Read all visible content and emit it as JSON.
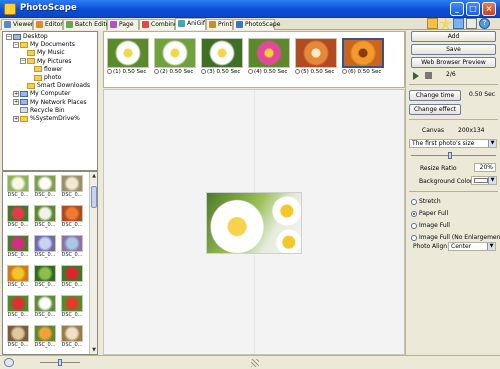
{
  "window": {
    "title": "PhotoScape"
  },
  "tabs": [
    {
      "label": "Viewer",
      "color": "#4f8bd6"
    },
    {
      "label": "Editor",
      "color": "#e08a2f"
    },
    {
      "label": "Batch Editor",
      "color": "#6aa84f"
    },
    {
      "label": "Page",
      "color": "#b64fc9"
    },
    {
      "label": "Combine",
      "color": "#d94b4b"
    },
    {
      "label": "AniGif",
      "color": "#3fa7b7"
    },
    {
      "label": "Print",
      "color": "#c78f2b"
    },
    {
      "label": "PhotoScape",
      "color": "#3b73c8"
    }
  ],
  "active_tab": "AniGif",
  "folder_tree": [
    {
      "label": "Desktop",
      "indent": 0,
      "expander": "-",
      "icon": "pc"
    },
    {
      "label": "My Documents",
      "indent": 1,
      "expander": "-",
      "icon": "folder"
    },
    {
      "label": "My Music",
      "indent": 2,
      "expander": "",
      "icon": "folder"
    },
    {
      "label": "My Pictures",
      "indent": 2,
      "expander": "-",
      "icon": "folder"
    },
    {
      "label": "flower",
      "indent": 3,
      "expander": "",
      "icon": "folder"
    },
    {
      "label": "photo",
      "indent": 3,
      "expander": "",
      "icon": "folder"
    },
    {
      "label": "Smart Downloads",
      "indent": 2,
      "expander": "",
      "icon": "folder"
    },
    {
      "label": "My Computer",
      "indent": 1,
      "expander": "+",
      "icon": "pc"
    },
    {
      "label": "My Network Places",
      "indent": 1,
      "expander": "+",
      "icon": "pc"
    },
    {
      "label": "Recycle Bin",
      "indent": 1,
      "expander": "",
      "icon": "bin"
    },
    {
      "label": "%SystemDrive%",
      "indent": 1,
      "expander": "+",
      "icon": "folder"
    }
  ],
  "thumbnails": [
    {
      "label": "DSC_0...",
      "c1": "#fbf7e8",
      "c2": "#8fb35a"
    },
    {
      "label": "DSC_0...",
      "c1": "#ffffff",
      "c2": "#7fa04a"
    },
    {
      "label": "DSC_0...",
      "c1": "#f2e9d2",
      "c2": "#9a8f6a"
    },
    {
      "label": "DSC_0...",
      "c1": "#e23c4a",
      "c2": "#3d7a2a"
    },
    {
      "label": "DSC_0...",
      "c1": "#f3f1ee",
      "c2": "#5b8a2c"
    },
    {
      "label": "DSC_0...",
      "c1": "#f07a32",
      "c2": "#a84d1f"
    },
    {
      "label": "DSC_0...",
      "c1": "#d72c86",
      "c2": "#4d7a27"
    },
    {
      "label": "DSC_0...",
      "c1": "#c9d4ee",
      "c2": "#6f6aa8"
    },
    {
      "label": "DSC_0...",
      "c1": "#a8c8e8",
      "c2": "#8f72a4"
    },
    {
      "label": "DSC_0...",
      "c1": "#f3c52d",
      "c2": "#cf7b17"
    },
    {
      "label": "DSC_0...",
      "c1": "#8fbf4a",
      "c2": "#2f6b22"
    },
    {
      "label": "DSC_0...",
      "c1": "#d8282b",
      "c2": "#3b7a2d"
    },
    {
      "label": "DSC_0...",
      "c1": "#e03030",
      "c2": "#4c8a2a"
    },
    {
      "label": "DSC_0...",
      "c1": "#ffffff",
      "c2": "#5e8d35"
    },
    {
      "label": "DSC_0...",
      "c1": "#e33b2c",
      "c2": "#4f8f2b"
    },
    {
      "label": "DSC_0...",
      "c1": "#e0c9a0",
      "c2": "#7a5c3a"
    },
    {
      "label": "DSC_0...",
      "c1": "#f3a23a",
      "c2": "#5f8a2a"
    },
    {
      "label": "DSC_0...",
      "c1": "#f0e0c8",
      "c2": "#9b7b4a"
    }
  ],
  "frames": [
    {
      "label": "(1) 0.50 Sec",
      "c1": "#f4d64a",
      "c2": "#ffffff",
      "c3": "#5a8a2b"
    },
    {
      "label": "(2) 0.50 Sec",
      "c1": "#f4d64a",
      "c2": "#ffffff",
      "c3": "#6fa23b"
    },
    {
      "label": "(3) 0.50 Sec",
      "c1": "#f4d64a",
      "c2": "#ffffff",
      "c3": "#3e6f25"
    },
    {
      "label": "(4) 0.50 Sec",
      "c1": "#f6d23a",
      "c2": "#e5489a",
      "c3": "#5b8a2b"
    },
    {
      "label": "(5) 0.50 Sec",
      "c1": "#f5e9d0",
      "c2": "#e6883a",
      "c3": "#b34a22"
    },
    {
      "label": "(6) 0.50 Sec",
      "c1": "#8a3a12",
      "c2": "#f29a2a",
      "c3": "#c9651c"
    }
  ],
  "right_panel": {
    "add_label": "Add",
    "save_label": "Save",
    "web_preview_label": "Web Browser Preview",
    "frame_counter": "2/6",
    "change_time_label": "Change time",
    "time_value": "0.50 Sec",
    "change_effect_label": "Change effect",
    "canvas_label": "Canvas",
    "canvas_value": "200x134",
    "size_option": "The first photo's size",
    "resize_label": "Resize Ratio",
    "resize_value": "20%",
    "bg_color_label": "Background Color",
    "bg_color": "#ffffff",
    "fit_options": [
      "Stretch",
      "Paper Full",
      "Image Full",
      "Image Full (No Enlargement)"
    ],
    "selected_fit": "Paper Full",
    "photo_align_label": "Photo Align",
    "photo_align_value": "Center"
  }
}
